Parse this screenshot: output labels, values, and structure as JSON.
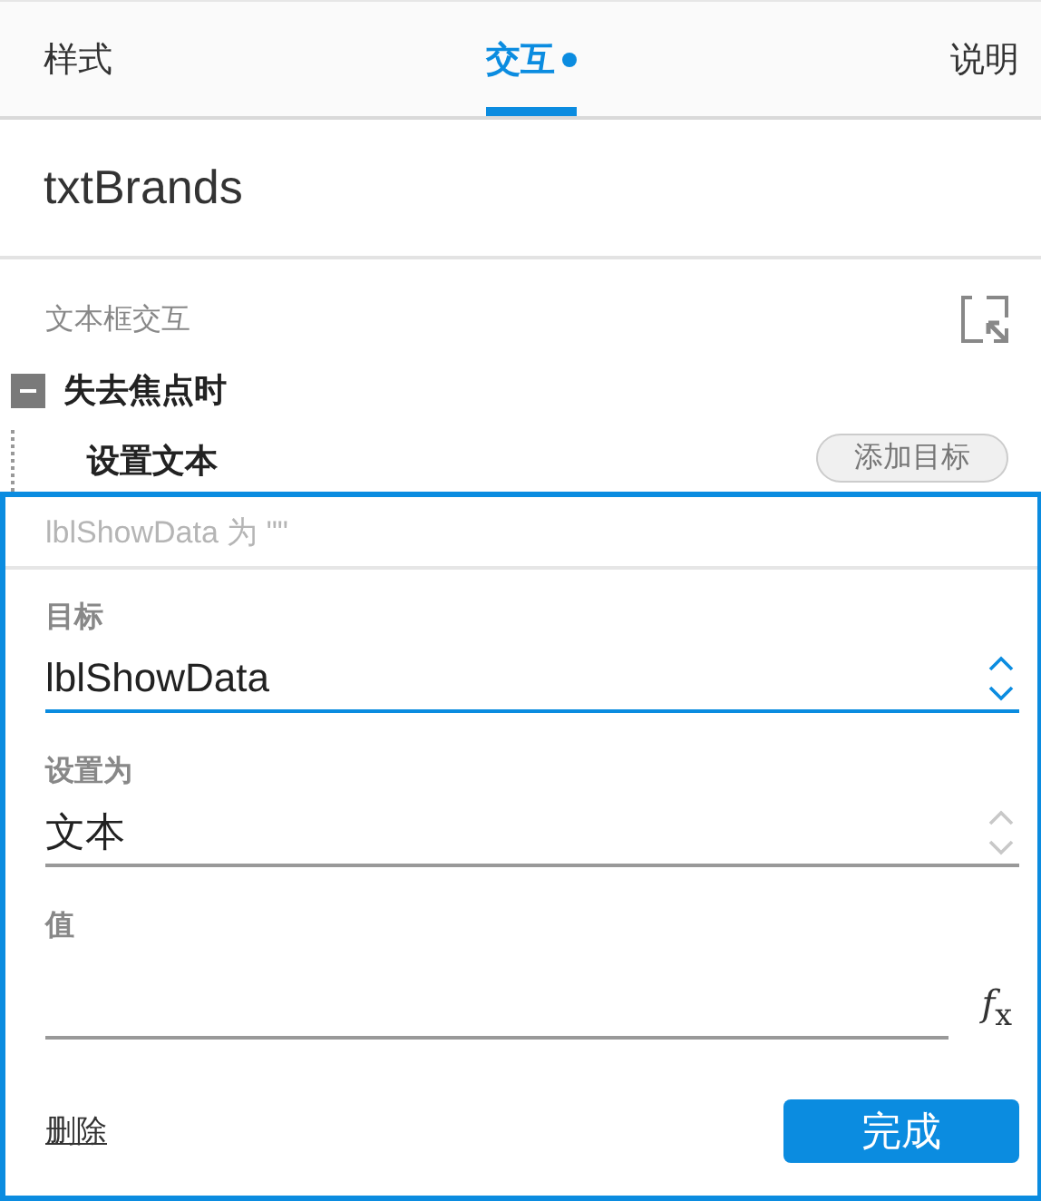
{
  "tabs": [
    {
      "label": "样式",
      "selected": false,
      "modified": false
    },
    {
      "label": "交互",
      "selected": true,
      "modified": true
    },
    {
      "label": "说明",
      "selected": false,
      "modified": false
    }
  ],
  "widget_name": "txtBrands",
  "section": {
    "title": "文本框交互",
    "event": {
      "label": "失去焦点时",
      "expanded": true,
      "action": {
        "label": "设置文本",
        "add_target_button": "添加目标"
      }
    }
  },
  "editor": {
    "summary": "lblShowData 为 \"\"",
    "fields": [
      {
        "kind": "select",
        "label": "目标",
        "value": "lblShowData",
        "focused": true
      },
      {
        "kind": "select",
        "label": "设置为",
        "value": "文本",
        "focused": false
      },
      {
        "kind": "formula",
        "label": "值",
        "focused": false,
        "button": "*f*$_{x}$"
      }
    ],
    "delete_link": "删除",
    "done_button": "完成"
  }
}
